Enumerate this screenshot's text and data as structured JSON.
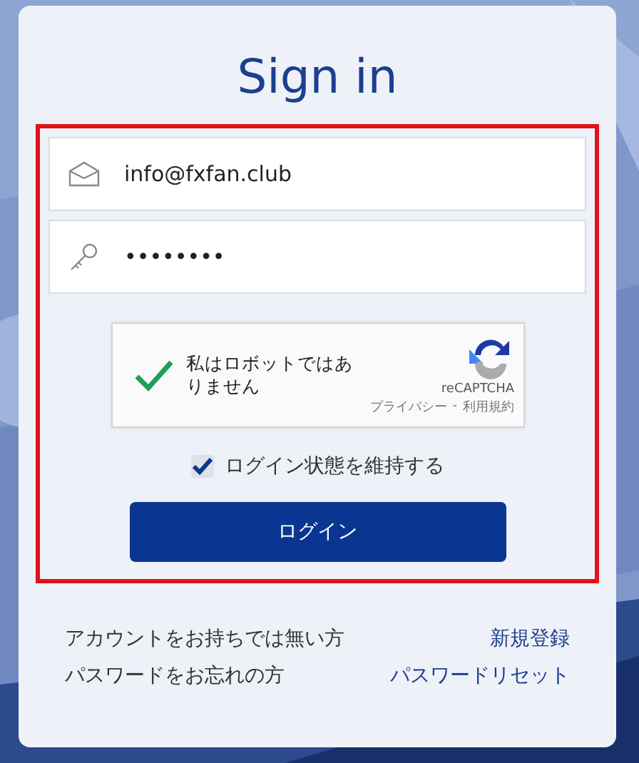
{
  "title": "Sign in",
  "email_field": {
    "value": "info@fxfan.club"
  },
  "password_field": {
    "value": "••••••••"
  },
  "recaptcha": {
    "checked": true,
    "label": "私はロボットではありません",
    "brand": "reCAPTCHA",
    "privacy": "プライバシー",
    "separator": "-",
    "terms": "利用規約"
  },
  "remember": {
    "checked": true,
    "label": "ログイン状態を維持する"
  },
  "login_button": {
    "label": "ログイン"
  },
  "links": [
    {
      "text": "アカウントをお持ちでは無い方",
      "link": "新規登録"
    },
    {
      "text": "パスワードをお忘れの方",
      "link": "パスワードリセット"
    }
  ]
}
